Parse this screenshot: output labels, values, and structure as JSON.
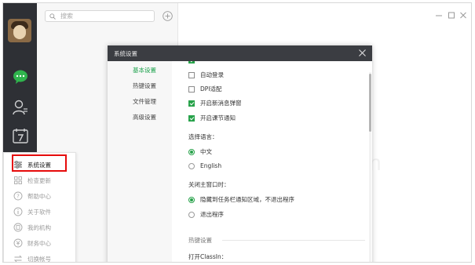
{
  "search": {
    "placeholder": "搜索"
  },
  "menu": {
    "items": [
      {
        "label": "系统设置",
        "icon": "sliders-icon"
      },
      {
        "label": "检查更新",
        "icon": "grid-icon"
      },
      {
        "label": "帮助中心",
        "icon": "help-icon"
      },
      {
        "label": "关于软件",
        "icon": "info-icon"
      },
      {
        "label": "我的机构",
        "icon": "building-icon"
      },
      {
        "label": "财务中心",
        "icon": "finance-icon"
      },
      {
        "label": "切换帐号",
        "icon": "switch-icon"
      }
    ]
  },
  "dialog": {
    "title": "系统设置",
    "nav": [
      {
        "label": "基本设置",
        "active": true
      },
      {
        "label": "热键设置",
        "active": false
      },
      {
        "label": "文件管理",
        "active": false
      },
      {
        "label": "高级设置",
        "active": false
      }
    ],
    "checkboxes": [
      {
        "label": "自动登录",
        "checked": false
      },
      {
        "label": "DPI适配",
        "checked": false
      },
      {
        "label": "开启新消息弹窗",
        "checked": true
      },
      {
        "label": "开启课节通知",
        "checked": true
      }
    ],
    "language": {
      "title": "选择语言：",
      "options": [
        {
          "label": "中文",
          "selected": true
        },
        {
          "label": "English",
          "selected": false
        }
      ]
    },
    "close_main": {
      "title": "关闭主窗口时：",
      "options": [
        {
          "label": "隐藏到任务栏通知区域，不退出程序",
          "selected": true
        },
        {
          "label": "退出程序",
          "selected": false
        }
      ]
    },
    "hotkey": {
      "title": "热键设置",
      "open_label": "打开ClassIn："
    }
  },
  "ghost_text": "n",
  "colors": {
    "accent": "#27a24a",
    "rail": "#2e3035",
    "highlight": "#e60b0b"
  }
}
